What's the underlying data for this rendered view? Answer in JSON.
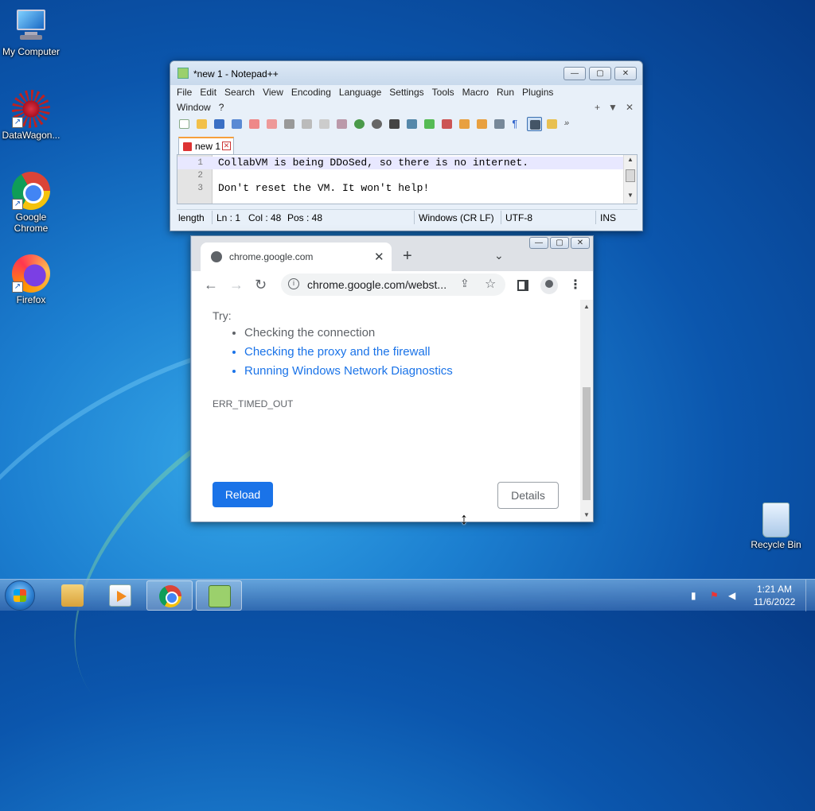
{
  "desktop": {
    "icons": [
      {
        "label": "My Computer",
        "icon": "computer-icon"
      },
      {
        "label": "DataWagon...",
        "icon": "datawagon-icon"
      },
      {
        "label": "Google Chrome",
        "icon": "chrome-icon"
      },
      {
        "label": "Firefox",
        "icon": "firefox-icon"
      },
      {
        "label": "Recycle Bin",
        "icon": "recycle-bin-icon"
      }
    ]
  },
  "notepadpp": {
    "title": "*new 1 - Notepad++",
    "menu": [
      "File",
      "Edit",
      "Search",
      "View",
      "Encoding",
      "Language",
      "Settings",
      "Tools",
      "Macro",
      "Run",
      "Plugins",
      "Window",
      "?"
    ],
    "menu_right": [
      "+",
      "▼",
      "✕"
    ],
    "tab": {
      "label": "new 1"
    },
    "lines": [
      {
        "num": "1",
        "text": "CollabVM is being DDoSed, so there is no internet."
      },
      {
        "num": "2",
        "text": ""
      },
      {
        "num": "3",
        "text": "Don't reset the VM. It won't help!"
      }
    ],
    "status": {
      "length": "length",
      "ln": "Ln : 1",
      "col": "Col : 48",
      "pos": "Pos : 48",
      "eol": "Windows (CR LF)",
      "encoding": "UTF-8",
      "mode": "INS"
    }
  },
  "chrome": {
    "tab_title": "chrome.google.com",
    "new_tab": "+",
    "url": "chrome.google.com/webst...",
    "content": {
      "try_label": "Try:",
      "suggestions": [
        {
          "text": "Checking the connection",
          "link": false
        },
        {
          "text": "Checking the proxy and the firewall",
          "link": true
        },
        {
          "text": "Running Windows Network Diagnostics",
          "link": true
        }
      ],
      "error_code": "ERR_TIMED_OUT",
      "reload_label": "Reload",
      "details_label": "Details"
    }
  },
  "taskbar": {
    "apps": [
      "explorer-icon",
      "media-player-icon",
      "chrome-icon",
      "notepadpp-icon"
    ],
    "active_app": "notepadpp-icon",
    "clock_time": "1:21 AM",
    "clock_date": "11/6/2022"
  },
  "colors": {
    "chrome_link": "#1a73e8",
    "reload_button": "#1a73e8",
    "npp_tab_accent": "#f7a03c"
  }
}
